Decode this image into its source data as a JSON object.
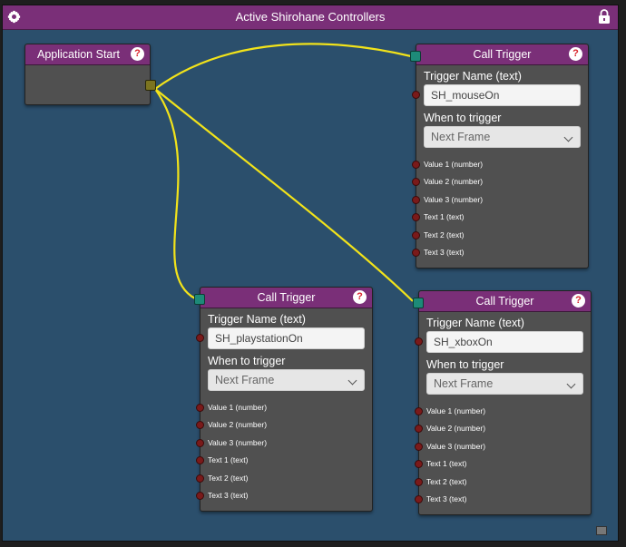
{
  "window": {
    "title": "Active Shirohane Controllers",
    "settings_icon": "gear-icon",
    "lock_icon": "lock-icon"
  },
  "colors": {
    "header": "#7a2f78",
    "canvas": "#2b4f6c",
    "node_body": "#505050",
    "wire": "#f2e31a",
    "input_port": "#1d8a78",
    "output_port": "#7c7420",
    "help": "#d8232a"
  },
  "start_node": {
    "title": "Application Start",
    "help": "?"
  },
  "trigger_nodes": [
    {
      "title": "Call Trigger",
      "help": "?",
      "name_label": "Trigger Name (text)",
      "name_value": "SH_mouseOn",
      "when_label": "When to trigger",
      "when_value": "Next Frame",
      "ports": [
        "Value 1 (number)",
        "Value 2 (number)",
        "Value 3 (number)",
        "Text 1 (text)",
        "Text 2 (text)",
        "Text 3 (text)"
      ]
    },
    {
      "title": "Call Trigger",
      "help": "?",
      "name_label": "Trigger Name (text)",
      "name_value": "SH_playstationOn",
      "when_label": "When to trigger",
      "when_value": "Next Frame",
      "ports": [
        "Value 1 (number)",
        "Value 2 (number)",
        "Value 3 (number)",
        "Text 1 (text)",
        "Text 2 (text)",
        "Text 3 (text)"
      ]
    },
    {
      "title": "Call Trigger",
      "help": "?",
      "name_label": "Trigger Name (text)",
      "name_value": "SH_xboxOn",
      "when_label": "When to trigger",
      "when_value": "Next Frame",
      "ports": [
        "Value 1 (number)",
        "Value 2 (number)",
        "Value 3 (number)",
        "Text 1 (text)",
        "Text 2 (text)",
        "Text 3 (text)"
      ]
    }
  ]
}
